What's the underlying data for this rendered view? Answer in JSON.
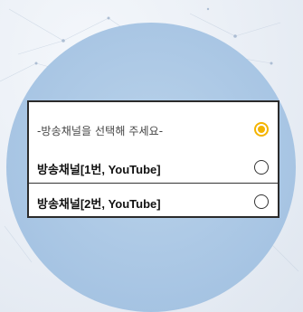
{
  "picker": {
    "options": [
      {
        "label": "-방송채널을 선택해 주세요-",
        "selected": true
      },
      {
        "label": "방송채널[1번, YouTube]",
        "selected": false
      },
      {
        "label": "방송채널[2번, YouTube]",
        "selected": false
      }
    ]
  },
  "colors": {
    "accent": "#f4b400",
    "border": "#2b2b2b",
    "circle": "#a9c6e4"
  },
  "icons": {
    "selected": "radio-selected-icon",
    "unselected": "radio-unselected-icon"
  }
}
